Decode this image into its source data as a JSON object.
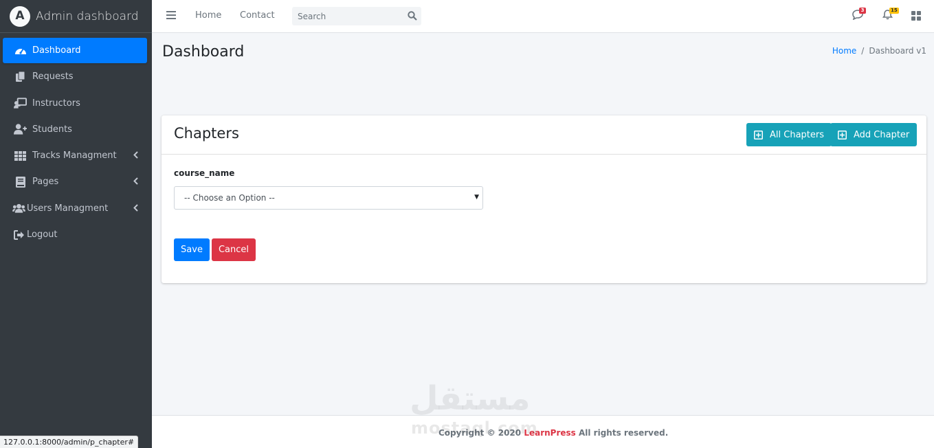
{
  "sidebar": {
    "brand_logo_letter": "A",
    "brand_title": "Admin dashboard",
    "items": [
      {
        "label": "Dashboard",
        "icon": "tachometer-icon",
        "active": true
      },
      {
        "label": "Requests",
        "icon": "copy-icon"
      },
      {
        "label": "Instructors",
        "icon": "chalkboard-teacher-icon"
      },
      {
        "label": "Students",
        "icon": "user-plus-icon"
      },
      {
        "label": "Tracks Managment",
        "icon": "th-icon",
        "has_submenu": true
      },
      {
        "label": "Pages",
        "icon": "book-icon",
        "has_submenu": true
      },
      {
        "label": "Users Managment",
        "icon": "users-icon",
        "has_submenu": true
      },
      {
        "label": "Logout",
        "icon": "sign-out-icon"
      }
    ]
  },
  "topbar": {
    "home_label": "Home",
    "contact_label": "Contact",
    "search_placeholder": "Search",
    "messages_badge": "3",
    "notifications_badge": "15",
    "colors": {
      "danger": "#dc3545",
      "warning": "#ffc107"
    }
  },
  "content": {
    "page_title": "Dashboard",
    "breadcrumb": {
      "home": "Home",
      "separator": "/",
      "current": "Dashboard v1"
    },
    "card": {
      "title": "Chapters",
      "all_chapters_label": "All Chapters",
      "add_chapter_label": "Add Chapter",
      "field_label": "course_name",
      "select_value": "-- Choose an Option --",
      "save_label": "Save",
      "cancel_label": "Cancel"
    }
  },
  "footer": {
    "prefix": "Copyright © 2020",
    "brand": "LearnPress",
    "suffix": "All rights reserved."
  },
  "watermark": {
    "arabic": "مستقل",
    "latin": "mostaql.com"
  },
  "statusbar": {
    "url": "127.0.0.1:8000/admin/p_chapter#"
  },
  "theme": {
    "sidebar_bg": "#343a40",
    "accent": "#007bff",
    "info": "#17a2b8",
    "danger": "#dc3545"
  }
}
